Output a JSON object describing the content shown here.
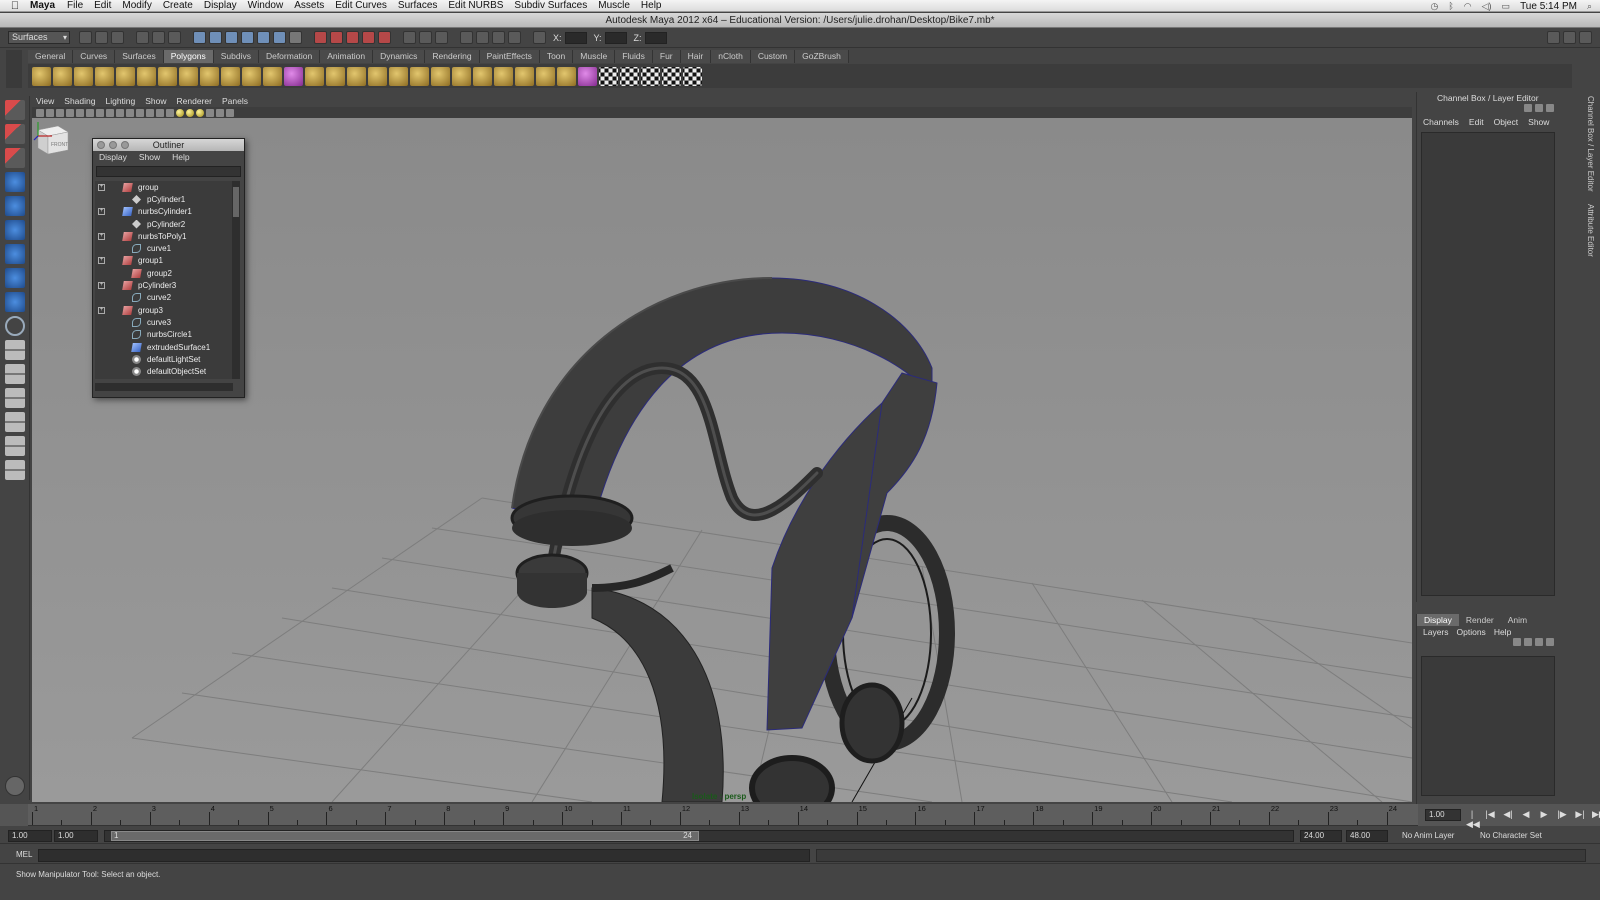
{
  "mac_menubar": {
    "app": "Maya",
    "items": [
      "File",
      "Edit",
      "Modify",
      "Create",
      "Display",
      "Window",
      "Assets",
      "Edit Curves",
      "Surfaces",
      "Edit NURBS",
      "Subdiv Surfaces",
      "Muscle",
      "Help"
    ],
    "clock": "Tue 5:14 PM"
  },
  "window_title": "Autodesk Maya 2012 x64 – Educational Version: /Users/julie.drohan/Desktop/Bike7.mb*",
  "status_line": {
    "menu_set": "Surfaces",
    "x_label": "X:",
    "y_label": "Y:",
    "z_label": "Z:"
  },
  "shelf": {
    "tabs": [
      "General",
      "Curves",
      "Surfaces",
      "Polygons",
      "Subdivs",
      "Deformation",
      "Animation",
      "Dynamics",
      "Rendering",
      "PaintEffects",
      "Toon",
      "Muscle",
      "Fluids",
      "Fur",
      "Hair",
      "nCloth",
      "Custom",
      "GoZBrush"
    ],
    "active_tab": "Polygons"
  },
  "panel_menu": [
    "View",
    "Shading",
    "Lighting",
    "Show",
    "Renderer",
    "Panels"
  ],
  "viewport": {
    "hud_isolate": "Isolate : persp",
    "view_cube_label": "FRONT"
  },
  "outliner": {
    "title": "Outliner",
    "menu": [
      "Display",
      "Show",
      "Help"
    ],
    "items": [
      {
        "name": "group",
        "type": "group",
        "expandable": true
      },
      {
        "name": "pCylinder1",
        "type": "mesh",
        "expandable": false
      },
      {
        "name": "nurbsCylinder1",
        "type": "nurbs",
        "expandable": true
      },
      {
        "name": "pCylinder2",
        "type": "mesh",
        "expandable": false
      },
      {
        "name": "nurbsToPoly1",
        "type": "group",
        "expandable": true
      },
      {
        "name": "curve1",
        "type": "curve",
        "expandable": false
      },
      {
        "name": "group1",
        "type": "group",
        "expandable": true
      },
      {
        "name": "group2",
        "type": "group",
        "expandable": false
      },
      {
        "name": "pCylinder3",
        "type": "group",
        "expandable": true
      },
      {
        "name": "curve2",
        "type": "curve",
        "expandable": false
      },
      {
        "name": "group3",
        "type": "group",
        "expandable": true
      },
      {
        "name": "curve3",
        "type": "curve",
        "expandable": false
      },
      {
        "name": "nurbsCircle1",
        "type": "curve",
        "expandable": false
      },
      {
        "name": "extrudedSurface1",
        "type": "nurbs",
        "expandable": false
      },
      {
        "name": "defaultLightSet",
        "type": "set",
        "expandable": false
      },
      {
        "name": "defaultObjectSet",
        "type": "set",
        "expandable": false
      }
    ]
  },
  "channel_box": {
    "title": "Channel Box / Layer Editor",
    "menu": [
      "Channels",
      "Edit",
      "Object",
      "Show"
    ]
  },
  "layer_editor": {
    "tabs": [
      "Display",
      "Render",
      "Anim"
    ],
    "active_tab": "Display",
    "menu": [
      "Layers",
      "Options",
      "Help"
    ]
  },
  "side_tabs": [
    "Channel Box / Layer Editor",
    "Attribute Editor"
  ],
  "time_slider": {
    "start": 1,
    "end": 24,
    "current_frame": "1.00"
  },
  "range_slider": {
    "start_time": "1.00",
    "playback_start": "1.00",
    "range_start_label": "1",
    "range_end_label": "24",
    "playback_end": "24.00",
    "end_time": "48.00",
    "anim_layer": "No Anim Layer",
    "character_set": "No Character Set"
  },
  "command_line": {
    "label": "MEL"
  },
  "help_line": "Show Manipulator Tool: Select an object.",
  "colors": {
    "ui_bg": "#444444",
    "viewport_bg": "#8f8f8f",
    "model": "#3a3a3a",
    "wire": "#2b2b7a"
  }
}
